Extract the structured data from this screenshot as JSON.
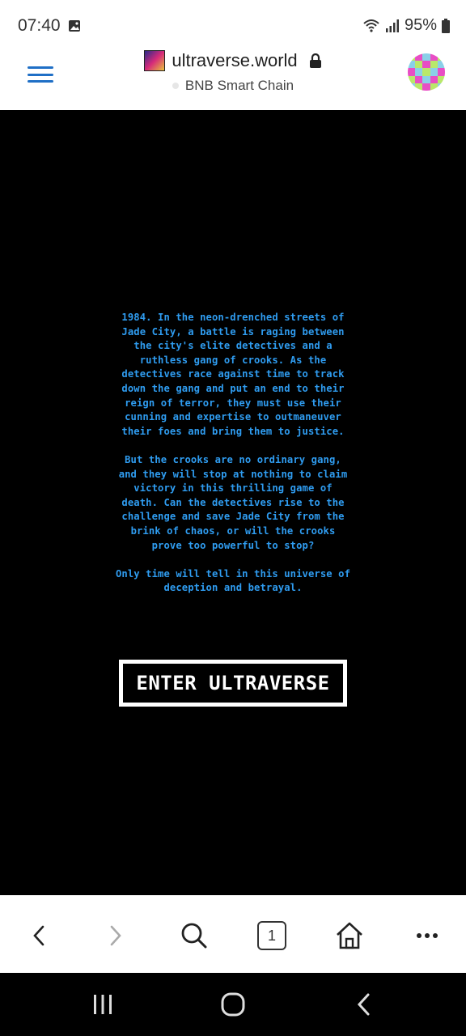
{
  "status_bar": {
    "time": "07:40",
    "battery": "95%",
    "icons": [
      "gallery-icon",
      "wifi-icon",
      "signal-icon",
      "battery-icon"
    ]
  },
  "header": {
    "site_title": "ultraverse.world",
    "chain": "BNB Smart Chain",
    "icons": [
      "menu-icon",
      "lock-icon",
      "avatar"
    ],
    "accent": "#1f6fc6"
  },
  "story": {
    "paragraph1": "1984. In the neon-drenched streets of Jade City, a battle is raging between the city's elite detectives and a ruthless gang of crooks. As the detectives race against time to track down the gang and put an end to their reign of terror, they must use their cunning and expertise to outmaneuver their foes and bring them to justice.",
    "paragraph2": "But the crooks are no ordinary gang, and they will stop at nothing to claim victory in this thrilling game of death. Can the detectives rise to the challenge and save Jade City from the brink of chaos, or will the crooks prove too powerful to stop?",
    "paragraph3": "Only time will tell in this universe of deception and betrayal.",
    "color": "#2f9cf0"
  },
  "enter_button": {
    "label": "ENTER ULTRAVERSE"
  },
  "browser_bar": {
    "tab_count": "1",
    "icons": [
      "back-icon",
      "forward-icon",
      "search-icon",
      "tabs-icon",
      "home-icon",
      "more-icon"
    ]
  },
  "nav_bar": {
    "icons": [
      "recents-icon",
      "home-circle-icon",
      "back-chevron-icon"
    ]
  }
}
